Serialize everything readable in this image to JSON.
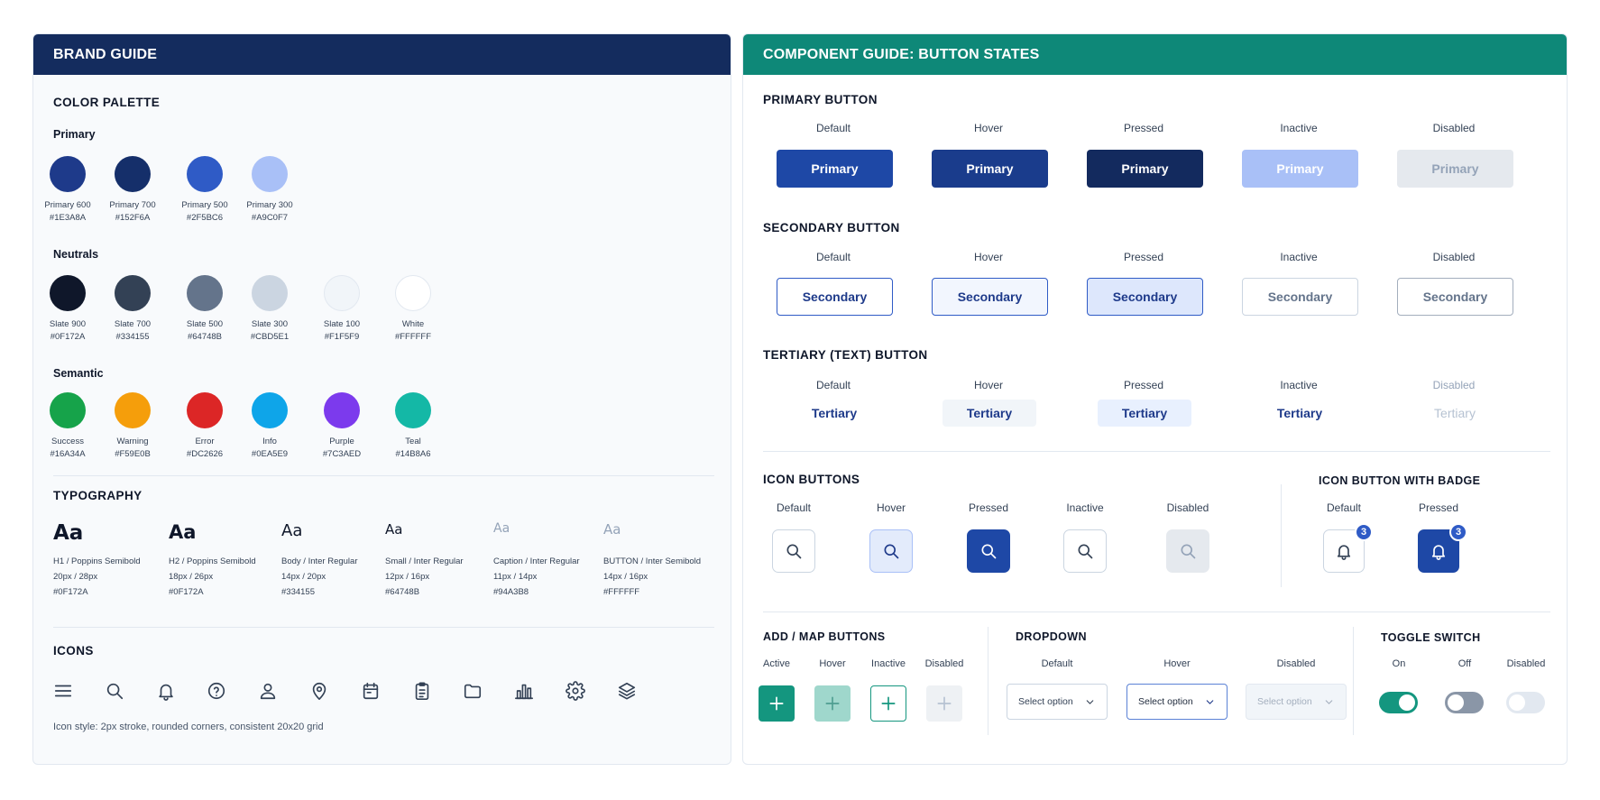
{
  "brand_guide": {
    "title": "BRAND GUIDE",
    "color_palette_title": "COLOR PALETTE",
    "primary_title": "Primary",
    "primary": [
      {
        "name": "Primary 600",
        "hex": "#1E3A8A"
      },
      {
        "name": "Primary 700",
        "hex": "#152F6A"
      },
      {
        "name": "Primary 500",
        "hex": "#2F5BC6"
      },
      {
        "name": "Primary 300",
        "hex": "#A9C0F7"
      }
    ],
    "neutrals_title": "Neutrals",
    "neutrals": [
      {
        "name": "Slate 900",
        "hex": "#0F172A"
      },
      {
        "name": "Slate 700",
        "hex": "#334155"
      },
      {
        "name": "Slate 500",
        "hex": "#64748B"
      },
      {
        "name": "Slate 300",
        "hex": "#CBD5E1"
      },
      {
        "name": "Slate 100",
        "hex": "#F1F5F9"
      },
      {
        "name": "White",
        "hex": "#FFFFFF"
      }
    ],
    "semantic_title": "Semantic",
    "semantic": [
      {
        "name": "Success",
        "hex": "#16A34A"
      },
      {
        "name": "Warning",
        "hex": "#F59E0B"
      },
      {
        "name": "Error",
        "hex": "#DC2626"
      },
      {
        "name": "Info",
        "hex": "#0EA5E9"
      },
      {
        "name": "Purple",
        "hex": "#7C3AED"
      },
      {
        "name": "Teal",
        "hex": "#14B8A6"
      }
    ],
    "typography_title": "TYPOGRAPHY",
    "typography": [
      {
        "sample": "Aa",
        "spec": "H1 / Poppins Semibold",
        "size": "20px / 28px",
        "color": "#0F172A"
      },
      {
        "sample": "Aa",
        "spec": "H2 / Poppins Semibold",
        "size": "18px / 26px",
        "color": "#0F172A"
      },
      {
        "sample": "Aa",
        "spec": "Body / Inter Regular",
        "size": "14px / 20px",
        "color": "#334155"
      },
      {
        "sample": "Aa",
        "spec": "Small / Inter Regular",
        "size": "12px / 16px",
        "color": "#64748B"
      },
      {
        "sample": "Aa",
        "spec": "Caption / Inter Regular",
        "size": "11px / 14px",
        "color": "#94A3B8"
      },
      {
        "sample": "Aa",
        "spec": "BUTTON / Inter Semibold",
        "size": "14px / 16px",
        "color": "#FFFFFF"
      }
    ],
    "icons_title": "ICONS",
    "icons": [
      "menu-icon",
      "search-icon",
      "bell-icon",
      "help-icon",
      "user-icon",
      "map-pin-icon",
      "calendar-icon",
      "clipboard-icon",
      "folder-icon",
      "bar-chart-icon",
      "gear-icon",
      "layers-icon"
    ],
    "icon_note": "Icon style: 2px stroke, rounded corners, consistent 20x20 grid"
  },
  "component_guide": {
    "title": "COMPONENT GUIDE: BUTTON STATES",
    "states": [
      "Default",
      "Hover",
      "Pressed",
      "Inactive",
      "Disabled"
    ],
    "primary_title": "PRIMARY BUTTON",
    "primary_label": "Primary",
    "secondary_title": "SECONDARY BUTTON",
    "secondary_label": "Secondary",
    "tertiary_title": "TERTIARY (TEXT) BUTTON",
    "tertiary_label": "Tertiary",
    "icon_buttons_title": "ICON BUTTONS",
    "icon_badge_title": "ICON BUTTON WITH BADGE",
    "badge_states": [
      "Default",
      "Pressed"
    ],
    "badge_count": "3",
    "add_title": "ADD / MAP BUTTONS",
    "add_states": [
      "Active",
      "Hover",
      "Inactive",
      "Disabled"
    ],
    "dropdown_title": "DROPDOWN",
    "dropdown_states": [
      "Default",
      "Hover",
      "Disabled"
    ],
    "dropdown_placeholder": "Select option",
    "toggle_title": "TOGGLE SWITCH",
    "toggle_states": [
      "On",
      "Off",
      "Disabled"
    ],
    "colors": {
      "teal": "#14967F",
      "primary_default": "#1E48A6",
      "primary_hover": "#1A3C8C",
      "primary_pressed": "#132A5E",
      "primary_inactive": "#A9C0F7",
      "disabled_bg": "#E5E9EE"
    }
  }
}
